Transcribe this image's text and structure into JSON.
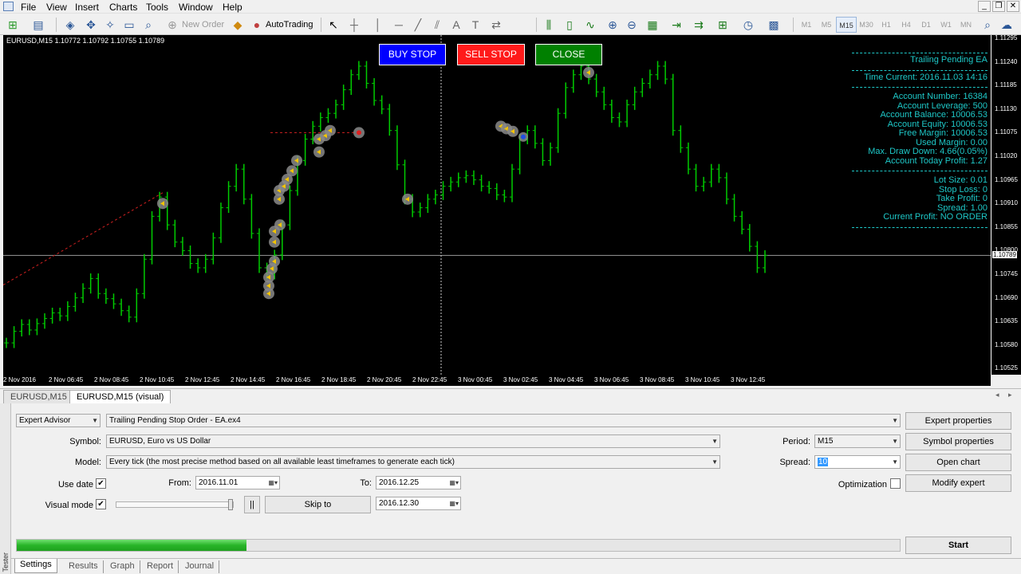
{
  "menu": [
    "File",
    "View",
    "Insert",
    "Charts",
    "Tools",
    "Window",
    "Help"
  ],
  "toolbar": {
    "new_order": "New Order",
    "autotrading": "AutoTrading",
    "timeframes": [
      "M1",
      "M5",
      "M15",
      "M30",
      "H1",
      "H4",
      "D1",
      "W1",
      "MN"
    ],
    "active_timeframe": "M15"
  },
  "chart": {
    "symbol_info": "EURUSD,M15  1.10772 1.10792 1.10755 1.10789",
    "buttons": {
      "buy_stop": "BUY STOP",
      "sell_stop": "SELL STOP",
      "close": "CLOSE"
    },
    "colors": {
      "background": "#000000",
      "candle": "#00cc00",
      "buy": "#0000ff",
      "sell": "#ff0000",
      "close": "#008000",
      "info": "#1ec8c8"
    },
    "info_panel": {
      "title": "Trailing Pending EA",
      "time_current": "Time Current: 2016.11.03 14:16",
      "account_number": "Account Number: 16384",
      "account_leverage": "Account Leverage: 500",
      "account_balance": "Account Balance: 10006.53",
      "account_equity": "Account Equity: 10006.53",
      "free_margin": "Free Margin: 10006.53",
      "used_margin": "Used Margin: 0.00",
      "max_draw_down": "Max. Draw Down: 4.66(0.05%)",
      "today_profit": "Account Today Profit: 1.27",
      "lot_size": "Lot Size: 0.01",
      "stop_loss": "Stop Loss: 0",
      "take_profit": "Take Profit: 0",
      "spread": "Spread: 1.00",
      "current_profit": "Current Profit: NO ORDER"
    },
    "price_labels": [
      "1.11295",
      "1.11240",
      "1.11185",
      "1.11130",
      "1.11075",
      "1.11020",
      "1.10965",
      "1.10910",
      "1.10855",
      "1.10800",
      "1.10745",
      "1.10690",
      "1.10635",
      "1.10580",
      "1.10525"
    ],
    "current_price": "1.10789",
    "time_labels": [
      "2 Nov 2016",
      "2 Nov 06:45",
      "2 Nov 08:45",
      "2 Nov 10:45",
      "2 Nov 12:45",
      "2 Nov 14:45",
      "2 Nov 16:45",
      "2 Nov 18:45",
      "2 Nov 20:45",
      "2 Nov 22:45",
      "3 Nov 00:45",
      "3 Nov 02:45",
      "3 Nov 04:45",
      "3 Nov 06:45",
      "3 Nov 08:45",
      "3 Nov 10:45",
      "3 Nov 12:45"
    ],
    "price_series": [
      1.10585,
      1.10612,
      1.10628,
      1.10615,
      1.1063,
      1.10642,
      1.10655,
      1.10648,
      1.1067,
      1.1069,
      1.10712,
      1.10735,
      1.107,
      1.10688,
      1.10676,
      1.1066,
      1.10645,
      1.107,
      1.1078,
      1.1088,
      1.10925,
      1.1086,
      1.1082,
      1.108,
      1.1077,
      1.1076,
      1.1078,
      1.1083,
      1.109,
      1.1095,
      1.1099,
      1.1092,
      1.1084,
      1.1076,
      1.10745,
      1.1079,
      1.1086,
      1.1094,
      1.1101,
      1.1106,
      1.1109,
      1.1111,
      1.1112,
      1.1114,
      1.11175,
      1.1121,
      1.1123,
      1.1119,
      1.1115,
      1.1113,
      1.1108,
      1.11,
      1.1092,
      1.1089,
      1.109,
      1.1092,
      1.1093,
      1.1095,
      1.1096,
      1.1097,
      1.10975,
      1.10965,
      1.1095,
      1.10945,
      1.1093,
      1.10925,
      1.1099,
      1.1106,
      1.1108,
      1.1105,
      1.1101,
      1.1104,
      1.1112,
      1.1118,
      1.1121,
      1.1123,
      1.112,
      1.1117,
      1.1114,
      1.1111,
      1.111,
      1.1114,
      1.1117,
      1.1119,
      1.1121,
      1.1123,
      1.112,
      1.1108,
      1.1104,
      1.1099,
      1.1095,
      1.1096,
      1.1099,
      1.1097,
      1.1092,
      1.1088,
      1.1085,
      1.1081,
      1.1076,
      1.10789
    ]
  },
  "chart_tabs": [
    "EURUSD,M15",
    "EURUSD,M15 (visual)"
  ],
  "tester": {
    "side_label": "Tester",
    "type": "Expert Advisor",
    "expert": "Trailing Pending Stop Order - EA.ex4",
    "symbol_label": "Symbol:",
    "symbol": "EURUSD, Euro vs US Dollar",
    "model_label": "Model:",
    "model": "Every tick (the most precise method based on all available least timeframes to generate each tick)",
    "period_label": "Period:",
    "period": "M15",
    "spread_label": "Spread:",
    "spread": "10",
    "use_date_label": "Use date",
    "use_date_checked": "✔",
    "from_label": "From:",
    "from": "2016.11.01",
    "to_label": "To:",
    "to": "2016.12.25",
    "visual_label": "Visual mode",
    "visual_checked": "✔",
    "pause": "||",
    "skip_to": "Skip to",
    "skip_date": "2016.12.30",
    "optimization_label": "Optimization",
    "buttons": {
      "expert_properties": "Expert properties",
      "symbol_properties": "Symbol properties",
      "open_chart": "Open chart",
      "modify_expert": "Modify expert",
      "start": "Start"
    },
    "progress_fraction": 0.26,
    "tabs": [
      "Settings",
      "Results",
      "Graph",
      "Report",
      "Journal"
    ]
  }
}
